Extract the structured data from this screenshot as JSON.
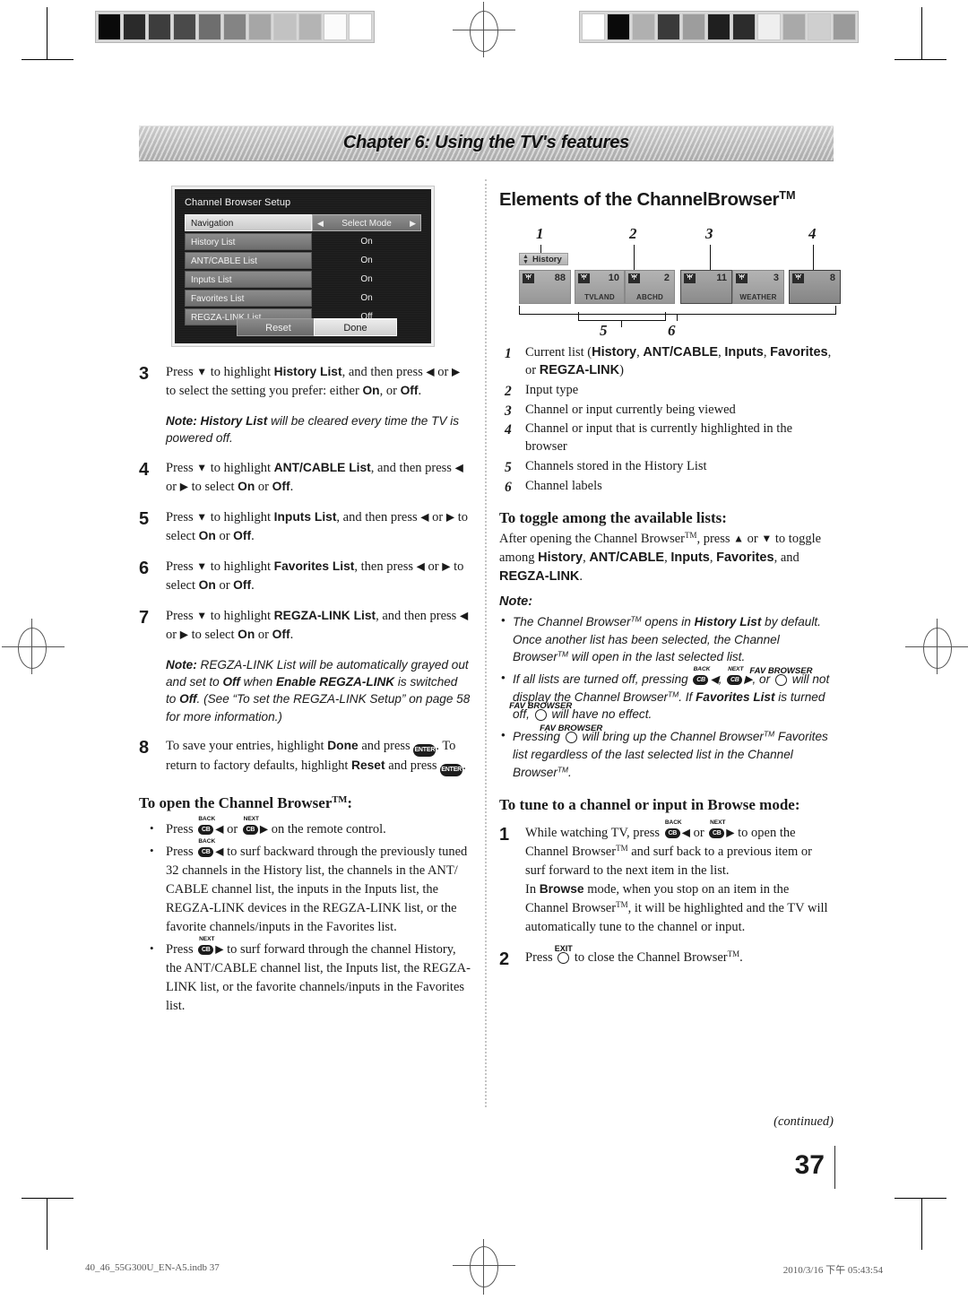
{
  "chapter": {
    "title": "Chapter 6: Using the TV's features"
  },
  "osd": {
    "title": "Channel Browser Setup",
    "rows": [
      {
        "label": "Navigation",
        "value": "Select Mode",
        "selected": true
      },
      {
        "label": "History List",
        "value": "On",
        "selected": false
      },
      {
        "label": "ANT/CABLE List",
        "value": "On",
        "selected": false
      },
      {
        "label": "Inputs List",
        "value": "On",
        "selected": false
      },
      {
        "label": "Favorites List",
        "value": "On",
        "selected": false
      },
      {
        "label": "REGZA-LINK List",
        "value": "Off",
        "selected": false
      }
    ],
    "reset_label": "Reset",
    "done_label": "Done"
  },
  "left": {
    "step3": {
      "num": "3",
      "text_a": "Press ",
      "arrow_down": "▼",
      "text_b": " to highlight ",
      "bold_a": "History List",
      "text_c": ", and then press ",
      "arrow_left": "◀",
      "text_d": " or ",
      "arrow_right": "▶",
      "text_e": " to select the setting you prefer: either ",
      "bold_b": "On",
      "text_f": ", or ",
      "bold_c": "Off",
      "text_g": "."
    },
    "note3": {
      "label": "Note: ",
      "bold": "History List",
      "text": " will be cleared every time the TV is powered off."
    },
    "step4": {
      "num": "4",
      "a": "Press ",
      "b": " to highlight ",
      "bold_a": "ANT/CABLE List",
      "c": ", and then press ",
      "d": " or ",
      "e": " to select ",
      "bold_b": "On",
      "f": " or ",
      "bold_c": "Off",
      "g": "."
    },
    "step5": {
      "num": "5",
      "a": "Press ",
      "b": " to highlight ",
      "bold_a": "Inputs List",
      "c": ", and then press ",
      "d": " or ",
      "e": " to select ",
      "bold_b": "On",
      "f": " or ",
      "bold_c": "Off",
      "g": "."
    },
    "step6": {
      "num": "6",
      "a": "Press ",
      "b": " to highlight ",
      "bold_a": "Favorites List",
      "c": ", then press ",
      "d": " or ",
      "e": " to select ",
      "bold_b": "On",
      "f": " or ",
      "bold_c": "Off",
      "g": "."
    },
    "step7": {
      "num": "7",
      "a": "Press ",
      "b": " to highlight ",
      "bold_a": "REGZA-LINK List",
      "c": ", and then press ",
      "d": " or ",
      "e": " to select ",
      "bold_b": "On",
      "f": " or ",
      "bold_c": "Off",
      "g": "."
    },
    "note7": {
      "label": "Note: ",
      "t1": "REGZA-LINK List will be automatically grayed out and set to ",
      "b1": "Off",
      "t2": " when ",
      "b2": "Enable REGZA-LINK",
      "t3": " is switched to ",
      "b3": "Off",
      "t4": ". (See “To set the REGZA-LINK Setup” on page 58 for more information.)"
    },
    "step8": {
      "num": "8",
      "a": "To save your entries, highlight ",
      "bold_a": "Done",
      "b": " and press ",
      "key1": "ENTER",
      "c": ". To return to factory defaults, highlight ",
      "bold_b": "Reset",
      "d": " and press ",
      "key2": "ENTER",
      "e": "."
    },
    "open_heading": "To open the Channel Browser",
    "bullets": [
      {
        "a": "Press ",
        "k1_tag": "BACK",
        "k1": "CB",
        "arr1": "◀",
        "b": " or ",
        "k2_tag": "NEXT",
        "k2": "CB",
        "arr2": "▶",
        "c": " on the remote control."
      },
      {
        "a": "Press ",
        "k1_tag": "BACK",
        "k1": "CB",
        "arr1": "◀",
        "b": " to surf backward through the previously tuned 32 channels in the History list, the channels in the ANT/ CABLE channel list, the inputs in the Inputs list, the REGZA-LINK devices in the REGZA-LINK list, or the favorite channels/inputs in the Favorites list."
      },
      {
        "a": "Press ",
        "k1_tag": "NEXT",
        "k1": "CB",
        "arr1": "▶",
        "b": " to surf forward through the channel History, the ANT/CABLE channel list, the Inputs list, the REGZA-LINK list, or the favorite channels/inputs in the Favorites list."
      }
    ]
  },
  "right": {
    "heading": "Elements of the ChannelBrowser",
    "figure": {
      "list_tag": "History",
      "callouts": [
        "1",
        "2",
        "3",
        "4"
      ],
      "brace_labels": [
        "5",
        "6"
      ],
      "tiles": [
        {
          "num": "88",
          "name": "",
          "state": "normal"
        },
        {
          "num": "10",
          "name": "TVLAND",
          "state": "normal"
        },
        {
          "num": "2",
          "name": "ABCHD",
          "state": "normal"
        },
        {
          "num": "11",
          "name": "",
          "state": "current"
        },
        {
          "num": "3",
          "name": "WEATHER",
          "state": "normal"
        },
        {
          "num": "8",
          "name": "",
          "state": "highlighted"
        }
      ]
    },
    "elements": [
      {
        "n": "1",
        "a": "Current list (",
        "b1": "History",
        "t1": ", ",
        "b2": "ANT/CABLE",
        "t2": ", ",
        "b3": "Inputs",
        "t3": ", ",
        "b4": "Favorites",
        "t4": ", or ",
        "b5": "REGZA-LINK",
        "t5": ")"
      },
      {
        "n": "2",
        "text": "Input type"
      },
      {
        "n": "3",
        "text": "Channel or input currently being viewed"
      },
      {
        "n": "4",
        "text": "Channel or input that is currently highlighted in the browser"
      },
      {
        "n": "5",
        "text": "Channels stored in the History List"
      },
      {
        "n": "6",
        "text": "Channel labels"
      }
    ],
    "toggle_heading": "To toggle among the available lists:",
    "toggle_text": {
      "a": "After opening the Channel Browser",
      "b": ", press ",
      "up": "▲",
      "c": " or ",
      "down": "▼",
      "d": " to toggle among ",
      "b1": "History",
      "t1": ", ",
      "b2": "ANT/CABLE",
      "t2": ", ",
      "b3": "Inputs",
      "t3": ", ",
      "b4": "Favorites",
      "t4": ", and ",
      "b5": "REGZA-LINK",
      "t5": "."
    },
    "note_heading": "Note:",
    "notes": [
      {
        "a": "The Channel Browser",
        "b": " opens in ",
        "bold": "History List",
        "c": " by default. Once another list has been selected, the Channel Browser",
        "d": " will open in the last selected list."
      },
      {
        "a": "If all lists are turned off, pressing ",
        "k1_tag": "BACK",
        "k1": "CB",
        "arr1": "◀",
        "b": ", ",
        "k2_tag": "NEXT",
        "k2": "CB",
        "arr2": "▶",
        "c": ", or ",
        "fav": "FAV BROWSER",
        "d": " will not display the Channel Browser",
        "e": ". If ",
        "bold": "Favorites List",
        "f": " is turned off, ",
        "fav2": "FAV BROWSER",
        "g": " will have no effect."
      },
      {
        "a": "Pressing ",
        "fav": "FAV BROWSER",
        "b": " will bring up the Channel Browser",
        "c": " Favorites list regardless of the last selected list in the Channel Browser",
        "d": "."
      }
    ],
    "tune_heading": "To tune to a channel or input in Browse mode:",
    "tune_steps": [
      {
        "n": "1",
        "a": "While watching TV, press ",
        "k1_tag": "BACK",
        "k1": "CB",
        "arr1": "◀",
        "b": " or ",
        "k2_tag": "NEXT",
        "k2": "CB",
        "arr2": "▶",
        "c": " to open the Channel Browser",
        "d": " and surf back to a previous item or surf forward to the next item in the list.",
        "e": "In ",
        "bold": "Browse",
        "f": " mode, when you stop on an item in the Channel Browser",
        "g": ", it will be highlighted and the TV will automatically tune to the channel or input."
      },
      {
        "n": "2",
        "a": "Press ",
        "key": "EXIT",
        "b": " to close the Channel Browser",
        "c": "."
      }
    ]
  },
  "footer": {
    "continued": "(continued)",
    "page_number": "37",
    "file": "40_46_55G300U_EN-A5.indb   37",
    "timestamp": "2010/3/16   下午 05:43:54"
  },
  "colorbars": {
    "left": [
      "#0a0a0a",
      "#2a2a2a",
      "#3d3d3d",
      "#4a4a4a",
      "#6e6e6e",
      "#848484",
      "#a6a6a6",
      "#c2c2c2",
      "#b4b4b4",
      "#fbfbfb",
      "#ffffff"
    ],
    "right": [
      "#ffffff",
      "#0a0a0a",
      "#b0b0b0",
      "#3a3a3a",
      "#9d9d9d",
      "#1f1f1f",
      "#2c2c2c",
      "#efefef",
      "#a9a9a9",
      "#cfcfcf",
      "#9a9a9a"
    ]
  },
  "trademark": "TM"
}
